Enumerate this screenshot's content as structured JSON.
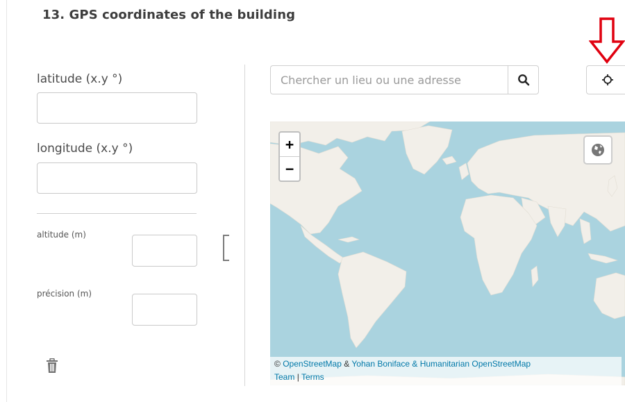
{
  "question": {
    "title": "13. GPS coordinates of the building"
  },
  "fields": {
    "latitude_label": "latitude (x.y °)",
    "latitude_value": "",
    "longitude_label": "longitude (x.y °)",
    "longitude_value": "",
    "altitude_label": "altitude (m)",
    "altitude_value": "",
    "precision_label": "précision (m)",
    "precision_value": ""
  },
  "search": {
    "placeholder": "Chercher un lieu ou une adresse",
    "button_icon": "search-icon"
  },
  "locate": {
    "icon": "locate-crosshair-icon"
  },
  "map": {
    "zoom_in": "+",
    "zoom_out": "−",
    "layers_icon": "globe-icon",
    "attribution": {
      "copyright": "©",
      "osm": "OpenStreetMap",
      "amp": "&",
      "authors": "Yohan Boniface & Humanitarian OpenStreetMap",
      "team": "Team",
      "sep": "|",
      "terms": "Terms"
    }
  },
  "colors": {
    "water": "#aad3df",
    "land": "#f2efe9",
    "arrow": "#e0000f",
    "link": "#0078a8"
  },
  "actions": {
    "delete_icon": "trash-icon"
  }
}
